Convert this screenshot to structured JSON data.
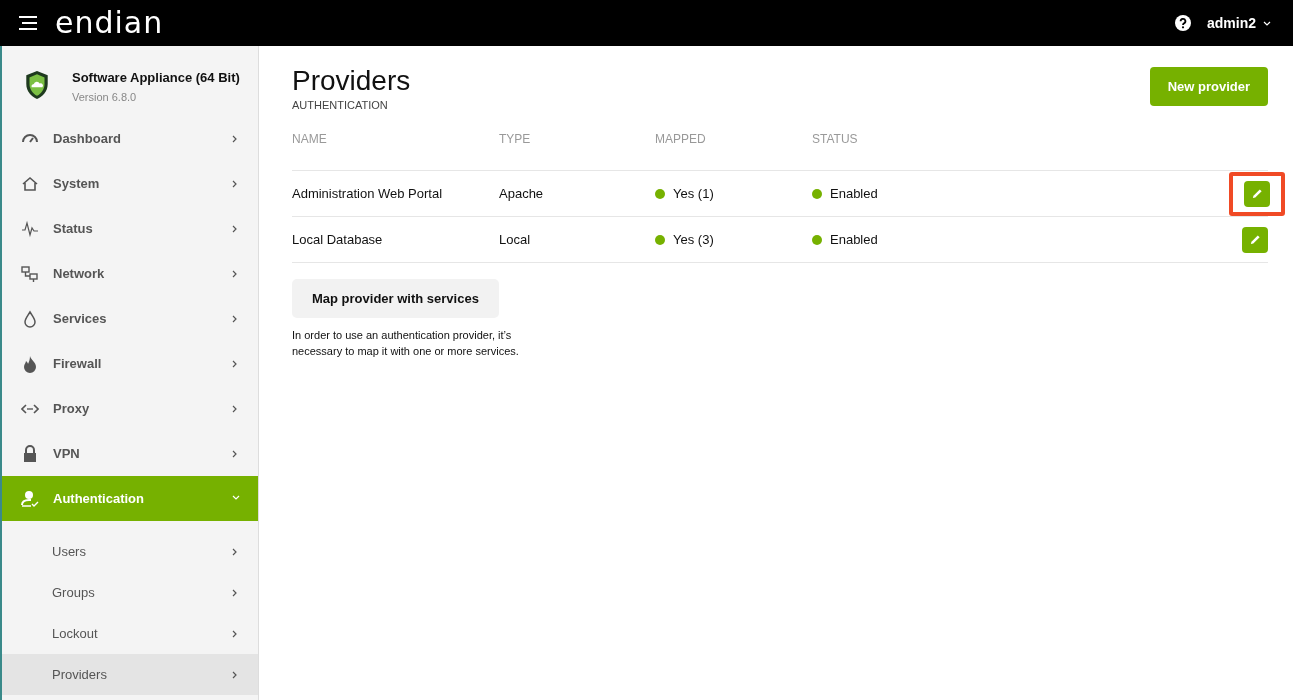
{
  "header": {
    "logo": "endian",
    "user": "admin2"
  },
  "appliance": {
    "name": "Software Appliance (64 Bit)",
    "version": "Version 6.8.0"
  },
  "sidebar": {
    "items": [
      {
        "label": "Dashboard",
        "expanded": false,
        "selected": false
      },
      {
        "label": "System",
        "expanded": false,
        "selected": false
      },
      {
        "label": "Status",
        "expanded": false,
        "selected": false
      },
      {
        "label": "Network",
        "expanded": false,
        "selected": false
      },
      {
        "label": "Services",
        "expanded": false,
        "selected": false
      },
      {
        "label": "Firewall",
        "expanded": false,
        "selected": false
      },
      {
        "label": "Proxy",
        "expanded": false,
        "selected": false
      },
      {
        "label": "VPN",
        "expanded": false,
        "selected": false
      },
      {
        "label": "Authentication",
        "expanded": true,
        "selected": true,
        "children": [
          {
            "label": "Users",
            "selected": false
          },
          {
            "label": "Groups",
            "selected": false
          },
          {
            "label": "Lockout",
            "selected": false
          },
          {
            "label": "Providers",
            "selected": true
          }
        ]
      }
    ]
  },
  "page": {
    "title": "Providers",
    "subtitle": "AUTHENTICATION",
    "new_button": "New provider"
  },
  "table": {
    "columns": [
      "NAME",
      "TYPE",
      "MAPPED",
      "STATUS"
    ],
    "rows": [
      {
        "name": "Administration Web Portal",
        "type": "Apache",
        "mapped": {
          "label": "Yes (1)",
          "color": "#76b100"
        },
        "status": {
          "label": "Enabled",
          "color": "#76b100"
        },
        "highlighted": true
      },
      {
        "name": "Local Database",
        "type": "Local",
        "mapped": {
          "label": "Yes (3)",
          "color": "#76b100"
        },
        "status": {
          "label": "Enabled",
          "color": "#76b100"
        },
        "highlighted": false
      }
    ]
  },
  "map_button": "Map provider with services",
  "note": "In order to use an authentication provider, it’s necessary to map it with one or more services."
}
